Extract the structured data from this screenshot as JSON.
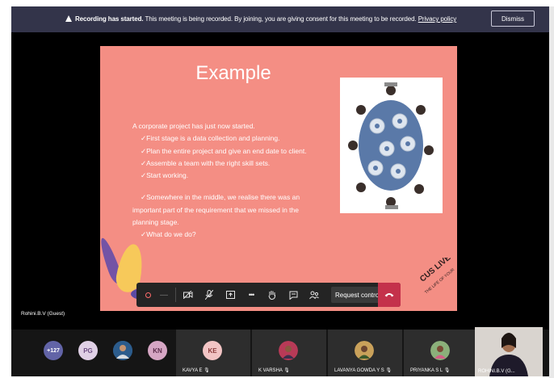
{
  "banner": {
    "bold": "Recording has started.",
    "text": "This meeting is being recorded. By joining, you are giving consent for this meeting to be recorded.",
    "link": "Privacy policy",
    "dismiss": "Dismiss"
  },
  "slide": {
    "title": "Example",
    "intro": "A corporate project has just now started.",
    "steps": [
      "✓First stage is a data collection and planning.",
      "✓Plan the entire project and give an end date to client.",
      "✓Assemble a team with the right skill sets.",
      "✓Start working."
    ],
    "middle_1": "✓Somewhere in the middle, we realise there was an",
    "middle_2": "important part of the requirement that we missed in the",
    "middle_3": "planning stage.",
    "question": "✓What do we do?"
  },
  "toolbar": {
    "more": "•••",
    "request_control": "Request control"
  },
  "presenter": "Rohini.B.V (Guest)",
  "gallery": {
    "overflow_count": "+127",
    "chips": [
      "PG",
      "KN"
    ],
    "tiles": [
      {
        "initials": "KE",
        "name": "KAVYA E"
      },
      {
        "name": "K VARSHA"
      },
      {
        "name": "LAVANYA GOWDA Y S"
      },
      {
        "name": "PRIYANKA S L"
      }
    ],
    "self_name": "ROHINI.B.V (G..."
  },
  "colors": {
    "banner_bg": "#33344a",
    "slide_bg": "#f48e84",
    "hangup": "#c4314b",
    "chip_purple": "#6264a7"
  }
}
